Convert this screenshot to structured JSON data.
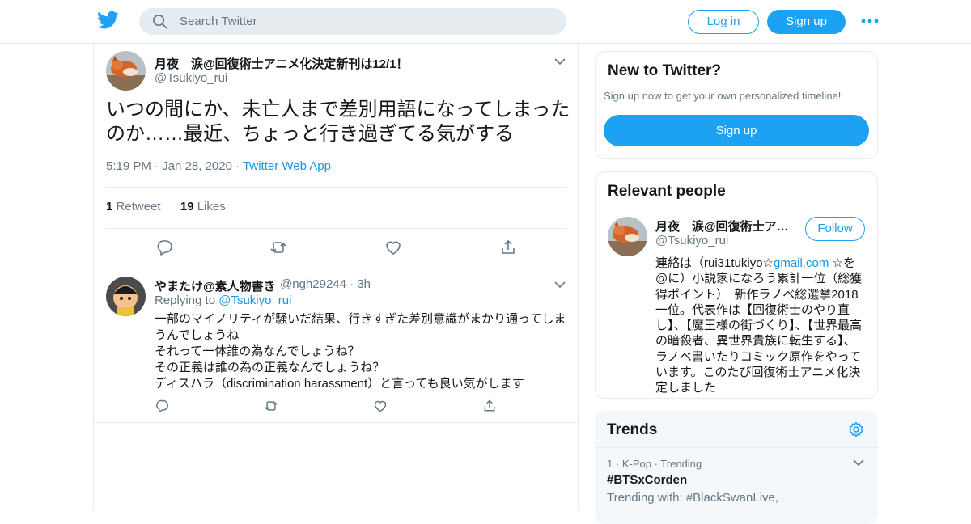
{
  "header": {
    "search_placeholder": "Search Twitter",
    "login_label": "Log in",
    "signup_label": "Sign up",
    "brand_color": "#1da1f2"
  },
  "main_tweet": {
    "display_name": "月夜　涙@回復術士アニメ化決定新刊は12/1！",
    "handle": "@Tsukiyo_rui",
    "text": "いつの間にか、未亡人まで差別用語になってしまったのか……最近、ちょっと行き過ぎてる気がする",
    "time": "5:19 PM",
    "date": "Jan 28, 2020",
    "source": "Twitter Web App",
    "retweet_count": "1",
    "retweet_label": "Retweet",
    "like_count": "19",
    "like_label": "Likes"
  },
  "reply_tweet": {
    "display_name": "やまたけ@素人物書き",
    "handle": "@ngh29244",
    "age": "3h",
    "replying_label": "Replying to",
    "replying_to": "@Tsukiyo_rui",
    "text": "一部のマイノリティが騒いだ結果、行きすぎた差別意識がまかり通ってしまうんでしょうね\nそれって一体誰の為なんでしょうね？\nその正義は誰の為の正義なんでしょうね？\nディスハラ（discrimination harassment）と言っても良い気がします"
  },
  "new_to_twitter": {
    "title": "New to Twitter?",
    "subtitle": "Sign up now to get your own personalized timeline!",
    "signup_label": "Sign up"
  },
  "relevant_people": {
    "title": "Relevant people",
    "name": "月夜　涙@回復術士ア…",
    "handle": "@Tsukiyo_rui",
    "follow_label": "Follow",
    "bio_before": "連絡は（rui31tukiyo☆",
    "bio_link": "gmail.com",
    "bio_after": " ☆を@に）小説家になろう累計一位（総獲得ポイント）　新作ラノベ総選挙2018一位。代表作は【回復術士のやり直し】、【魔王様の街づくり】、【世界最高の暗殺者、異世界貴族に転生する】、ラノベ書いたりコミック原作をやっています。このたび回復術士アニメ化決定しました"
  },
  "trends": {
    "title": "Trends",
    "items": [
      {
        "rank": "1",
        "category": "K-Pop",
        "status": "Trending",
        "name": "#BTSxCorden",
        "with_text": "Trending with: #BlackSwanLive,"
      }
    ]
  }
}
